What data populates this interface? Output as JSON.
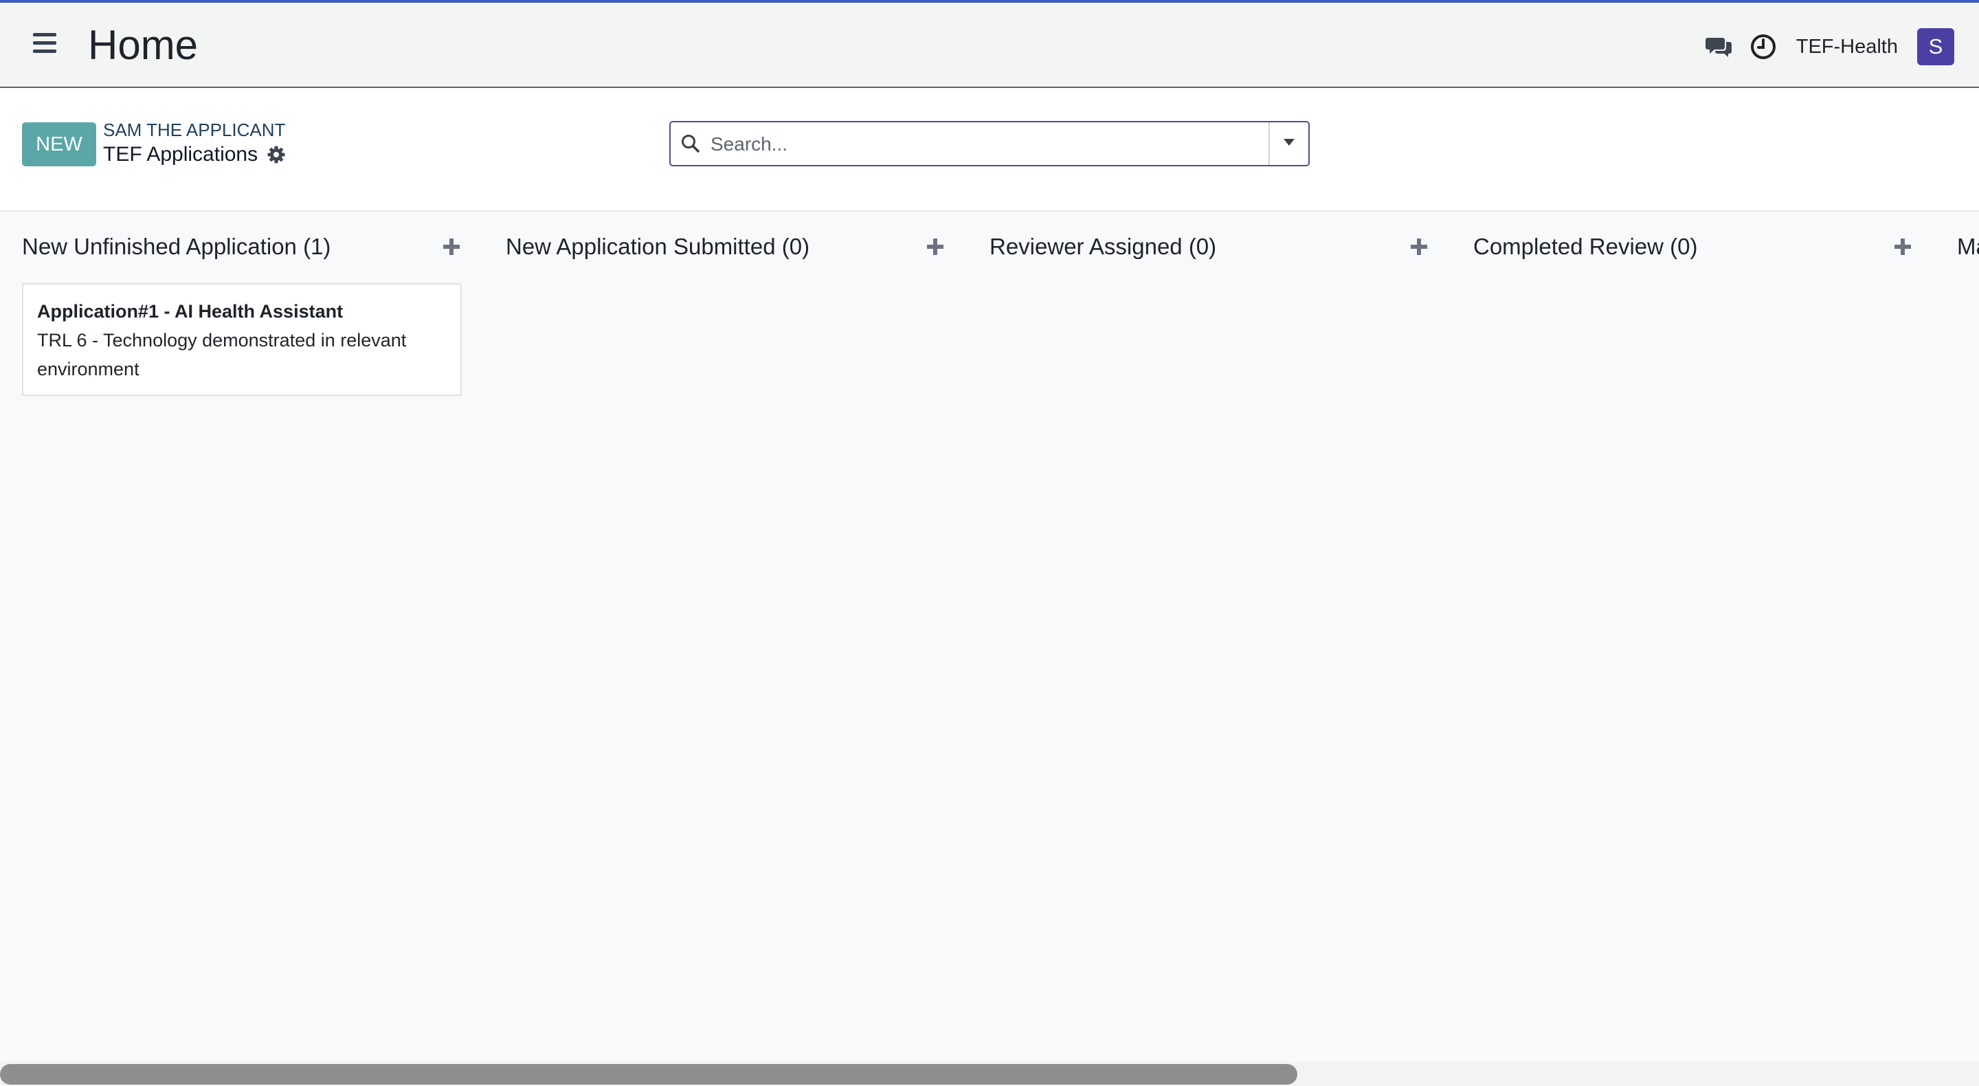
{
  "navbar": {
    "title": "Home",
    "company": "TEF-Health",
    "avatar_initial": "S",
    "icons": [
      "menu-icon",
      "chat-icon",
      "clock-icon"
    ]
  },
  "control_panel": {
    "new_button": "NEW",
    "breadcrumb_parent": "SAM THE APPLICANT",
    "breadcrumb_current": "TEF Applications",
    "search_placeholder": "Search..."
  },
  "kanban": {
    "columns": [
      {
        "title": "New Unfinished Application (1)",
        "cards": [
          {
            "title": "Application#1 - AI Health Assistant",
            "subtitle": "TRL 6 - Technology demonstrated in relevant environment"
          }
        ]
      },
      {
        "title": "New Application Submitted (0)",
        "cards": []
      },
      {
        "title": "Reviewer Assigned (0)",
        "cards": []
      },
      {
        "title": "Completed Review (0)",
        "cards": []
      },
      {
        "title": "Ma",
        "cards": []
      }
    ]
  },
  "colors": {
    "new_button": "#5ba6a6",
    "avatar": "#4b3fa3",
    "top_accent": "#3c5bbf"
  }
}
